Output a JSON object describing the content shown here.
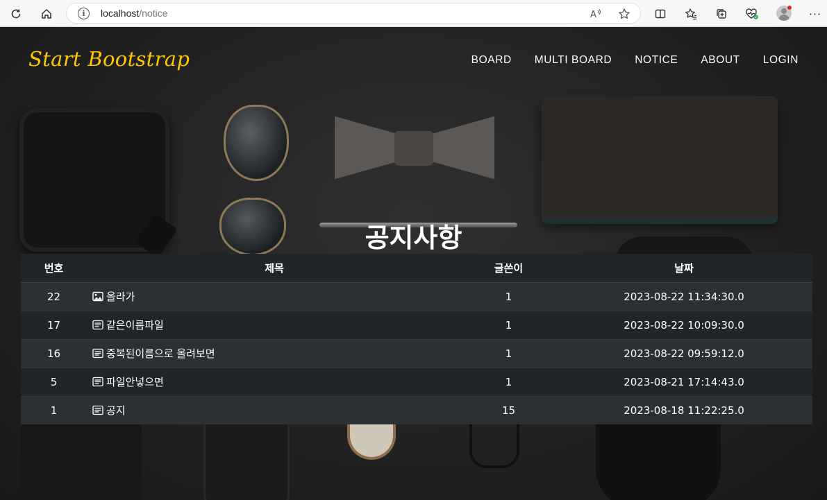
{
  "browser": {
    "url_host": "localhost",
    "url_path": "/notice"
  },
  "navbar": {
    "brand": "Start Bootstrap",
    "items": [
      "BOARD",
      "MULTI BOARD",
      "NOTICE",
      "ABOUT",
      "LOGIN"
    ]
  },
  "page": {
    "heading": "공지사항"
  },
  "table": {
    "columns": [
      "번호",
      "제목",
      "글쓴이",
      "날짜"
    ],
    "rows": [
      {
        "no": "22",
        "icon": "image-icon",
        "title": "올라가",
        "writer": "1",
        "date": "2023-08-22 11:34:30.0"
      },
      {
        "no": "17",
        "icon": "document-icon",
        "title": "같은이름파일",
        "writer": "1",
        "date": "2023-08-22 10:09:30.0"
      },
      {
        "no": "16",
        "icon": "document-icon",
        "title": "중복된이름으로 올려보면",
        "writer": "1",
        "date": "2023-08-22 09:59:12.0"
      },
      {
        "no": "5",
        "icon": "document-icon",
        "title": "파일안넣으면",
        "writer": "1",
        "date": "2023-08-21 17:14:43.0"
      },
      {
        "no": "1",
        "icon": "document-icon",
        "title": "공지",
        "writer": "15",
        "date": "2023-08-18 11:22:25.0"
      }
    ]
  },
  "colors": {
    "brand": "#ffc800",
    "table_header": "#212529",
    "table_row_odd": "#2c3034",
    "table_row_even": "#212529"
  }
}
